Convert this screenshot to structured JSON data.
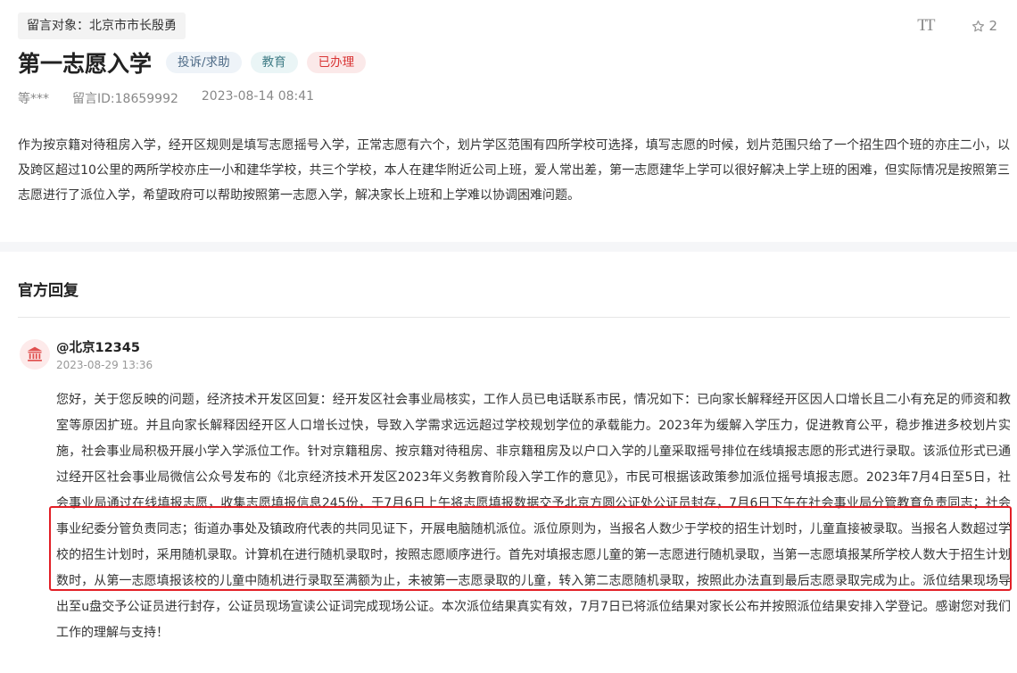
{
  "message": {
    "target_label": "留言对象：北京市市长殷勇",
    "font_toggle_label": "TT",
    "favorite_count": "2",
    "title": "第一志愿入学",
    "tags": [
      {
        "label": "投诉/求助",
        "type": "category"
      },
      {
        "label": "教育",
        "type": "topic"
      },
      {
        "label": "已办理",
        "type": "status"
      }
    ],
    "author": "等***",
    "message_id": "留言ID:18659992",
    "datetime": "2023-08-14 08:41",
    "body": "作为按京籍对待租房入学，经开区规则是填写志愿摇号入学，正常志愿有六个，划片学区范围有四所学校可选择，填写志愿的时候，划片范围只给了一个招生四个班的亦庄二小，以及跨区超过10公里的两所学校亦庄一小和建华学校，共三个学校，本人在建华附近公司上班，爱人常出差，第一志愿建华上学可以很好解决上学上班的困难，但实际情况是按照第三志愿进行了派位入学，希望政府可以帮助按照第一志愿入学，解决家长上班和上学难以协调困难问题。"
  },
  "reply": {
    "heading": "官方回复",
    "replier": "@北京12345",
    "date": "2023-08-29 13:36",
    "avatar_icon": "government-building-icon",
    "body": "您好，关于您反映的问题，经济技术开发区回复：经开发区社会事业局核实，工作人员已电话联系市民，情况如下：已向家长解释经开区因人口增长且二小有充足的师资和教室等原因扩班。并且向家长解释因经开区人口增长过快，导致入学需求远远超过学校规划学位的承载能力。2023年为缓解入学压力，促进教育公平，稳步推进多校划片实施，社会事业局积极开展小学入学派位工作。针对京籍租房、按京籍对待租房、非京籍租房及以户口入学的儿童采取摇号排位在线填报志愿的形式进行录取。该派位形式已通过经开区社会事业局微信公众号发布的《北京经济技术开发区2023年义务教育阶段入学工作的意见》，市民可根据该政策参加派位摇号填报志愿。2023年7月4日至5日，社会事业局通过在线填报志愿，收集志愿填报信息245份，于7月6日上午将志愿填报数据交予北京方圆公证处公证员封存，7月6日下午在社会事业局分管教育负责同志；社会事业纪委分管负责同志；街道办事处及镇政府代表的共同见证下，开展电脑随机派位。派位原则为，当报名人数少于学校的招生计划时，儿童直接被录取。当报名人数超过学校的招生计划时，采用随机录取。计算机在进行随机录取时，按照志愿顺序进行。首先对填报志愿儿童的第一志愿进行随机录取，当第一志愿填报某所学校人数大于招生计划数时，从第一志愿填报该校的儿童中随机进行录取至满额为止，未被第一志愿录取的儿童，转入第二志愿随机录取，按照此办法直到最后志愿录取完成为止。派位结果现场导出至u盘交予公证员进行封存，公证员现场宣读公证词完成现场公证。本次派位结果真实有效，7月7日已将派位结果对家长公布并按照派位结果安排入学登记。感谢您对我们工作的理解与支持！"
  },
  "colors": {
    "status_tag": "#d93535",
    "highlight_border": "#e21f26",
    "avatar_bg": "#fdeaea",
    "avatar_icon": "#e0504f"
  }
}
